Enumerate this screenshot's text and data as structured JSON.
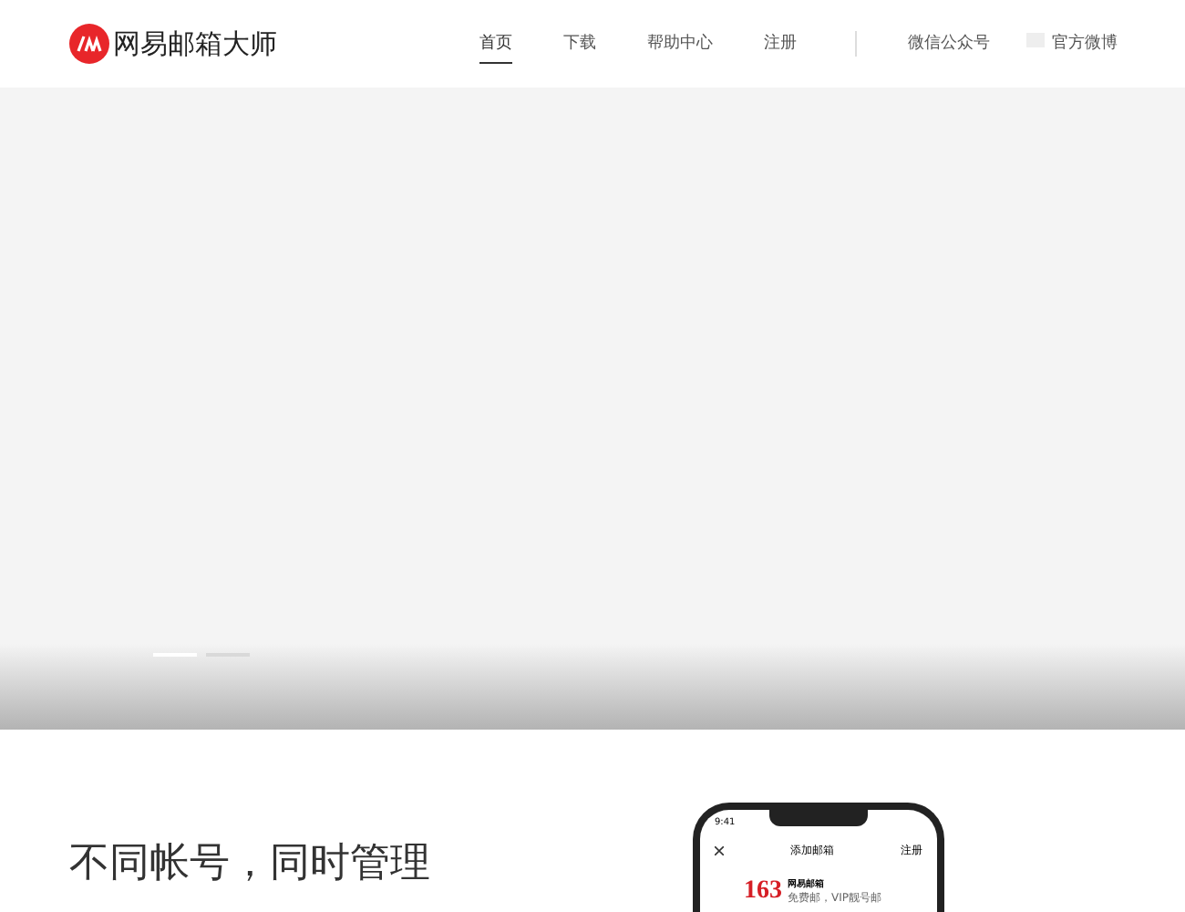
{
  "header": {
    "brand": "网易邮箱大师",
    "nav": [
      {
        "label": "首页",
        "selected": true
      },
      {
        "label": "下载",
        "selected": false
      },
      {
        "label": "帮助中心",
        "selected": false
      },
      {
        "label": "注册",
        "selected": false
      }
    ],
    "social": [
      {
        "label": "微信公众号"
      },
      {
        "label": "官方微博"
      }
    ]
  },
  "hero": {
    "slides": [
      {
        "selected": true
      },
      {
        "selected": false
      }
    ]
  },
  "feature": {
    "heading": "不同帐号，同时管理",
    "phone": {
      "time": "9:41",
      "title": "添加邮箱",
      "action": "注册",
      "logo_number": "163",
      "logo_name": "网易邮箱",
      "logo_tagline": "免费邮，VIP靓号邮"
    }
  }
}
